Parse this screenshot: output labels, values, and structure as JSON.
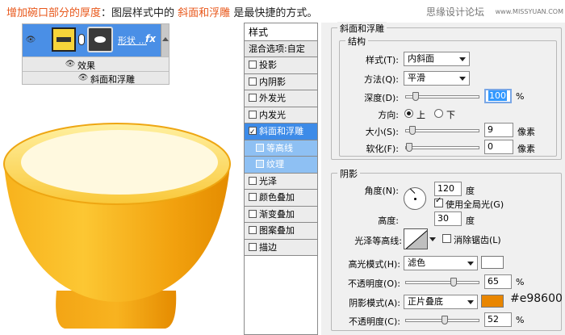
{
  "title": {
    "part1": "增加碗口部分的厚度",
    "part2": "：图层样式中的",
    "part3": "斜面和浮雕",
    "part4": "是最快捷的方式。"
  },
  "watermark": {
    "cn": "思缘设计论坛",
    "url": "www.MISSYUAN.COM"
  },
  "layers_panel": {
    "layer_name": "形状 ...",
    "fx": "fx",
    "effects_label": "效果",
    "bevel_label": "斜面和浮雕"
  },
  "styles_list": {
    "header": "样式",
    "blend_options": "混合选项:自定",
    "items": [
      {
        "label": "投影"
      },
      {
        "label": "内阴影"
      },
      {
        "label": "外发光"
      },
      {
        "label": "内发光"
      },
      {
        "label": "斜面和浮雕"
      },
      {
        "label": "等高线"
      },
      {
        "label": "纹理"
      },
      {
        "label": "光泽"
      },
      {
        "label": "颜色叠加"
      },
      {
        "label": "渐变叠加"
      },
      {
        "label": "图案叠加"
      },
      {
        "label": "描边"
      }
    ]
  },
  "bevel": {
    "section_title": "斜面和浮雕",
    "structure_title": "结构",
    "style_label": "样式(T):",
    "style_value": "内斜面",
    "technique_label": "方法(Q):",
    "technique_value": "平滑",
    "depth_label": "深度(D):",
    "depth_value": "100",
    "depth_unit": "%",
    "depth_fraction": 0.1,
    "direction_label": "方向:",
    "direction_up": "上",
    "direction_down": "下",
    "size_label": "大小(S):",
    "size_value": "9",
    "size_unit": "像素",
    "size_fraction": 0.05,
    "soften_label": "软化(F):",
    "soften_value": "0",
    "soften_unit": "像素",
    "soften_fraction": 0.0
  },
  "shading": {
    "title": "阴影",
    "angle_label": "角度(N):",
    "angle_value": "120",
    "angle_unit": "度",
    "global_light_label": "使用全局光(G)",
    "altitude_label": "高度:",
    "altitude_value": "30",
    "altitude_unit": "度",
    "gloss_label": "光泽等高线:",
    "anti_alias_label": "消除锯齿(L)",
    "highlight_mode_label": "高光模式(H):",
    "highlight_mode_value": "滤色",
    "highlight_color": "#ffffff",
    "highlight_opacity_label": "不透明度(O):",
    "highlight_opacity_value": "65",
    "highlight_opacity_unit": "%",
    "highlight_opacity_fraction": 0.65,
    "shadow_mode_label": "阴影模式(A):",
    "shadow_mode_value": "正片叠底",
    "shadow_color": "#e98600",
    "shadow_color_note": "#e98600",
    "shadow_opacity_label": "不透明度(C):",
    "shadow_opacity_value": "52",
    "shadow_opacity_unit": "%",
    "shadow_opacity_fraction": 0.52
  },
  "colors": {
    "selection": "#3d8be8",
    "bowl_inner": "#fff9df",
    "bowl_outer": "#f3a413",
    "bowl_rim": "#fcd44e"
  }
}
